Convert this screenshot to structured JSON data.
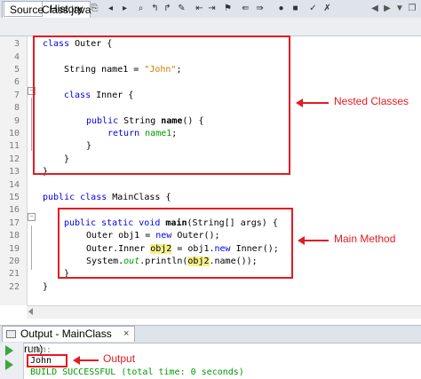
{
  "editor_tab": {
    "filename": "MainClass.java",
    "close_glyph": "×"
  },
  "toolbar": {
    "source_label": "Source",
    "history_label": "History"
  },
  "line_numbers": [
    "3",
    "4",
    "5",
    "6",
    "7",
    "8",
    "9",
    "10",
    "11",
    "12",
    "13",
    "14",
    "15",
    "16",
    "17",
    "18",
    "19",
    "20",
    "21",
    "22"
  ],
  "code": {
    "l3": {
      "kw": "class",
      "rest": " Outer {"
    },
    "l5": {
      "pre": "String name1 = ",
      "str": "\"John\"",
      "post": ";"
    },
    "l7": {
      "kw": "class",
      "rest": " Inner {"
    },
    "l9": {
      "kw": "public",
      "pre": " String ",
      "method": "name",
      "post": "() {"
    },
    "l10": {
      "kw": "return",
      "field": "name1",
      "post": ";"
    },
    "l11": {
      "text": "}"
    },
    "l12": {
      "text": "}"
    },
    "l13": {
      "text": "}"
    },
    "l15": {
      "kw": "public class",
      "rest": " MainClass {"
    },
    "l17": {
      "kw": "public static void",
      "method": "main",
      "post": "(String[] args) {"
    },
    "l18": {
      "pre": "Outer obj1 = ",
      "kw": "new",
      "post": " Outer();"
    },
    "l19": {
      "pre": "Outer.Inner ",
      "hl": "obj2",
      "mid": " = obj1.",
      "kw": "new",
      "post": " Inner();"
    },
    "l20": {
      "pre": "System.",
      "out": "out",
      "mid": ".println(",
      "hl": "obj2",
      "post": ".name());"
    },
    "l21": {
      "text": "}"
    },
    "l22": {
      "text": "}"
    }
  },
  "annotations": {
    "nested": "Nested Classes",
    "main": "Main Method",
    "output": "Output",
    "color": "#e31b23"
  },
  "output_panel": {
    "tab_label": "Output - MainClass (run)",
    "close_glyph": "×",
    "lines": [
      "run:",
      "John",
      "BUILD SUCCESSFUL (total time: 0 seconds)"
    ]
  }
}
